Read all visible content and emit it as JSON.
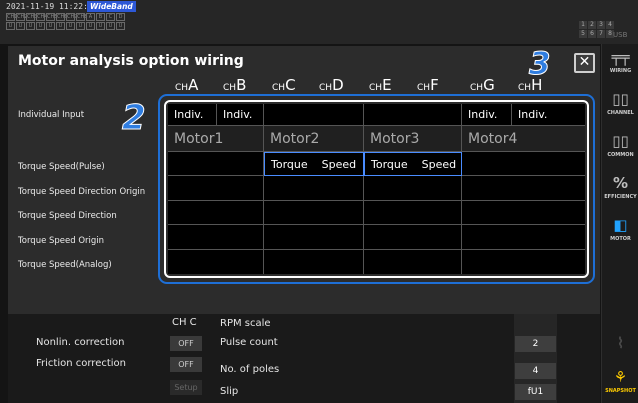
{
  "status": {
    "timestamp": "2021-11-19 11:22:03",
    "mode_badge": "WideBand",
    "channels_row1": [
      "CH1",
      "CH2",
      "CH3",
      "CH4",
      "CH5",
      "CH6",
      "CH7",
      "CH8",
      "A",
      "B",
      "C",
      "D"
    ],
    "channels_row2": [
      "U",
      "U",
      "U",
      "U",
      "U",
      "U",
      "U",
      "U",
      "U",
      "U",
      "U",
      "U"
    ],
    "page_numbers": [
      "1",
      "2",
      "3",
      "4",
      "5",
      "6",
      "7",
      "8"
    ],
    "usb": "USB"
  },
  "side_menu": [
    {
      "label": "WIRING",
      "icon": "wiring-icon",
      "glyph": "╤╤"
    },
    {
      "label": "CHANNEL",
      "icon": "channel-icon",
      "glyph": "▯▯"
    },
    {
      "label": "COMMON",
      "icon": "common-icon",
      "glyph": "▯▯"
    },
    {
      "label": "EFFICIENCY",
      "icon": "efficiency-icon",
      "glyph": "%"
    },
    {
      "label": "MOTOR",
      "icon": "motor-icon",
      "glyph": "◧"
    },
    {
      "label": "",
      "icon": "dim-icon",
      "glyph": "⌇"
    },
    {
      "label": "SNAPSHOT",
      "icon": "snapshot-icon",
      "glyph": "⚘"
    }
  ],
  "dialog": {
    "title": "Motor analysis option wiring",
    "close_label": "✕",
    "callout_2": "2",
    "callout_3": "3",
    "channels": [
      {
        "prefix": "CH",
        "letter": "A"
      },
      {
        "prefix": "CH",
        "letter": "B"
      },
      {
        "prefix": "CH",
        "letter": "C"
      },
      {
        "prefix": "CH",
        "letter": "D"
      },
      {
        "prefix": "CH",
        "letter": "E"
      },
      {
        "prefix": "CH",
        "letter": "F"
      },
      {
        "prefix": "CH",
        "letter": "G"
      },
      {
        "prefix": "CH",
        "letter": "H"
      }
    ],
    "row_labels": [
      "Individual Input",
      "Torque  Speed(Pulse)",
      "Torque  Speed  Direction  Origin",
      "Torque  Speed  Direction",
      "Torque  Speed  Origin",
      "Torque  Speed(Analog)"
    ],
    "row1": [
      "Indiv.",
      "Indiv.",
      "",
      "",
      "Indiv.",
      "Indiv."
    ],
    "motors": [
      "Motor1",
      "Motor2",
      "Motor3",
      "Motor4"
    ],
    "pulse_row": [
      "Torque",
      "Speed",
      "Torque",
      "Speed"
    ]
  },
  "bottom": {
    "ch_label": "CH C",
    "nonlin_label": "Nonlin. correction",
    "nonlin_value": "OFF",
    "friction_label": "Friction correction",
    "friction_value": "OFF",
    "setup_label": "Setup",
    "rpm_label": "RPM scale",
    "pulse_label": "Pulse count",
    "poles_label": "No. of poles",
    "slip_label": "Slip",
    "pulse_value": "2",
    "poles_value": "4",
    "slip_value": "fU1"
  }
}
